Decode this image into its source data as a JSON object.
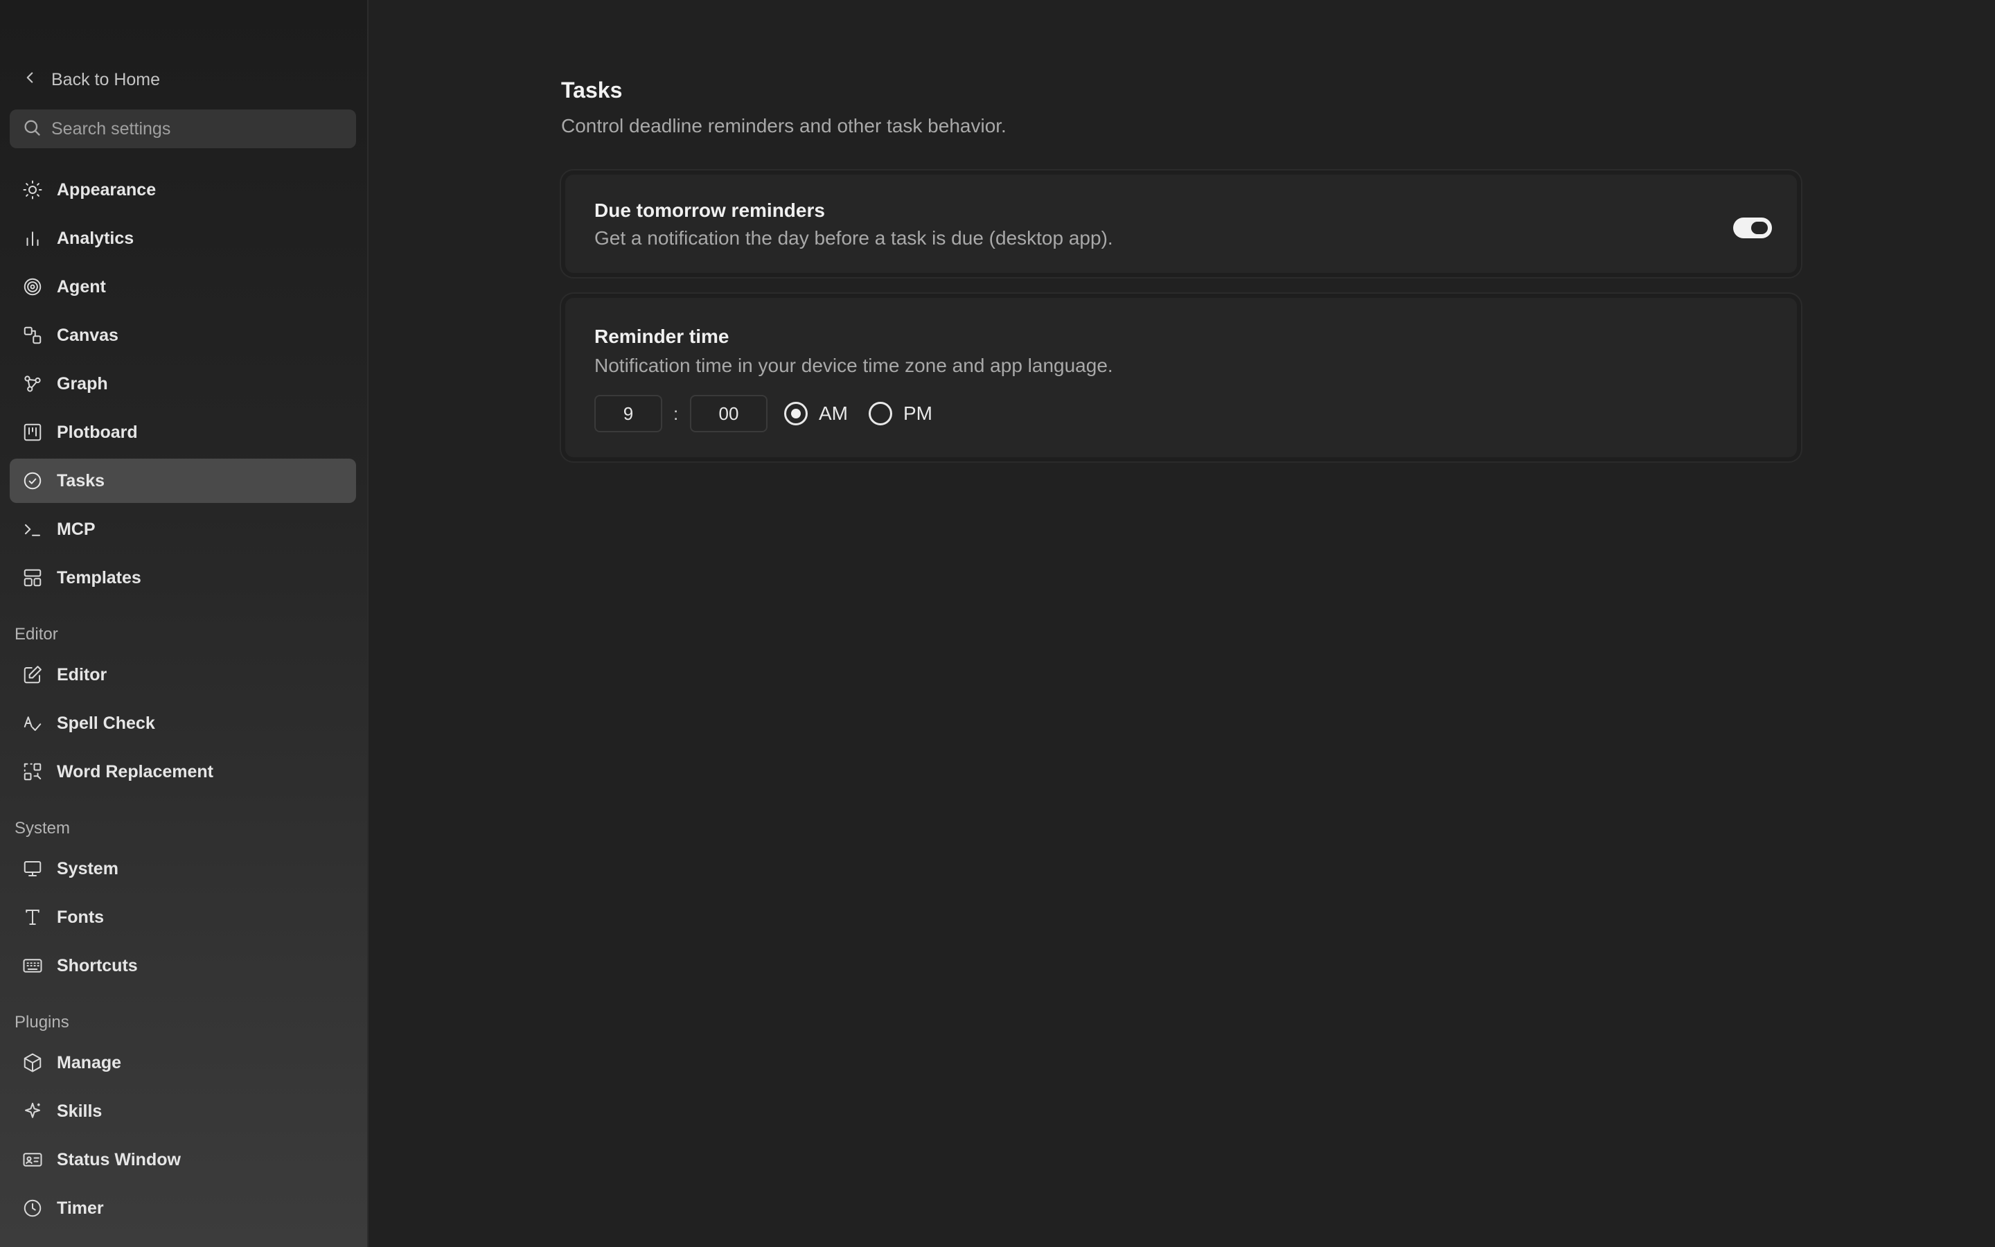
{
  "sidebar": {
    "back_label": "Back to Home",
    "search_placeholder": "Search settings",
    "items": [
      {
        "label": "Appearance",
        "icon": "sun-icon"
      },
      {
        "label": "Analytics",
        "icon": "bar-chart-icon"
      },
      {
        "label": "Agent",
        "icon": "spiral-icon"
      },
      {
        "label": "Canvas",
        "icon": "canvas-icon"
      },
      {
        "label": "Graph",
        "icon": "graph-icon"
      },
      {
        "label": "Plotboard",
        "icon": "kanban-icon"
      },
      {
        "label": "Tasks",
        "icon": "check-circle-icon",
        "active": true
      },
      {
        "label": "MCP",
        "icon": "terminal-icon"
      },
      {
        "label": "Templates",
        "icon": "layout-icon"
      }
    ],
    "sections": [
      {
        "label": "Editor",
        "items": [
          {
            "label": "Editor",
            "icon": "edit-icon"
          },
          {
            "label": "Spell Check",
            "icon": "spell-check-icon"
          },
          {
            "label": "Word Replacement",
            "icon": "replace-icon"
          }
        ]
      },
      {
        "label": "System",
        "items": [
          {
            "label": "System",
            "icon": "monitor-icon"
          },
          {
            "label": "Fonts",
            "icon": "type-icon"
          },
          {
            "label": "Shortcuts",
            "icon": "keyboard-icon"
          }
        ]
      },
      {
        "label": "Plugins",
        "items": [
          {
            "label": "Manage",
            "icon": "package-icon"
          },
          {
            "label": "Skills",
            "icon": "sparkle-icon"
          },
          {
            "label": "Status Window",
            "icon": "id-card-icon"
          },
          {
            "label": "Timer",
            "icon": "clock-icon"
          }
        ]
      }
    ]
  },
  "main": {
    "title": "Tasks",
    "subtitle": "Control deadline reminders and other task behavior.",
    "due_reminders": {
      "title": "Due tomorrow reminders",
      "description": "Get a notification the day before a task is due (desktop app).",
      "enabled": true
    },
    "reminder_time": {
      "title": "Reminder time",
      "description": "Notification time in your device time zone and app language.",
      "hour": "9",
      "separator": ":",
      "minute": "00",
      "am_label": "AM",
      "pm_label": "PM",
      "selected_period": "AM"
    }
  },
  "colors": {
    "background": "#212121",
    "sidebar_active": "#4a4a4a",
    "card": "#262626",
    "toggle_on": "#f2f2f2"
  }
}
